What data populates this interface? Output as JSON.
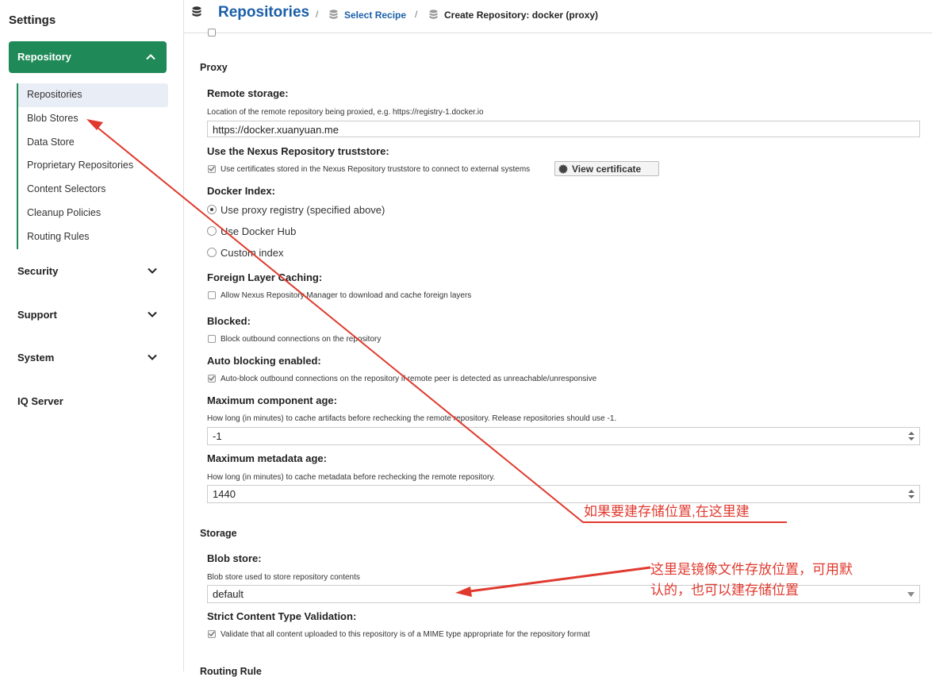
{
  "sidebar": {
    "title": "Settings",
    "repository_label": "Repository",
    "items": [
      "Repositories",
      "Blob Stores",
      "Data Store",
      "Proprietary Repositories",
      "Content Selectors",
      "Cleanup Policies",
      "Routing Rules"
    ],
    "sections": [
      "Security",
      "Support",
      "System",
      "IQ Server"
    ]
  },
  "breadcrumb": {
    "title": "Repositories",
    "sep": "/",
    "recipe": "Select Recipe",
    "current": "Create Repository: docker (proxy)"
  },
  "proxy": {
    "section_title": "Proxy",
    "remote_label": "Remote storage:",
    "remote_help": "Location of the remote repository being proxied, e.g. https://registry-1.docker.io",
    "remote_value": "https://docker.xuanyuan.me",
    "truststore_label": "Use the Nexus Repository truststore:",
    "truststore_cb": "Use certificates stored in the Nexus Repository truststore to connect to external systems",
    "view_cert_button": "View certificate",
    "docker_index_label": "Docker Index:",
    "docker_index_options": [
      "Use proxy registry (specified above)",
      "Use Docker Hub",
      "Custom index"
    ],
    "foreign_label": "Foreign Layer Caching:",
    "foreign_cb": "Allow Nexus Repository Manager to download and cache foreign layers",
    "blocked_label": "Blocked:",
    "blocked_cb": "Block outbound connections on the repository",
    "auto_label": "Auto blocking enabled:",
    "auto_cb": "Auto-block outbound connections on the repository if remote peer is detected as unreachable/unresponsive",
    "max_comp_label": "Maximum component age:",
    "max_comp_help": "How long (in minutes) to cache artifacts before rechecking the remote repository. Release repositories should use -1.",
    "max_comp_value": "-1",
    "max_meta_label": "Maximum metadata age:",
    "max_meta_help": "How long (in minutes) to cache metadata before rechecking the remote repository.",
    "max_meta_value": "1440"
  },
  "storage": {
    "section_title": "Storage",
    "blob_label": "Blob store:",
    "blob_help": "Blob store used to store repository contents",
    "blob_value": "default",
    "strict_label": "Strict Content Type Validation:",
    "strict_cb": "Validate that all content uploaded to this repository is of a MIME type appropriate for the repository format"
  },
  "routing": {
    "section_title": "Routing Rule"
  },
  "annotations": {
    "note1": "如果要建存储位置,在这里建",
    "note2_line1": "这里是镜像文件存放位置，可用默",
    "note2_line2": "认的，也可以建存储位置"
  },
  "colors": {
    "accent": "#1f8a57",
    "link": "#1a5fa8",
    "annotation": "#e03a2f"
  }
}
